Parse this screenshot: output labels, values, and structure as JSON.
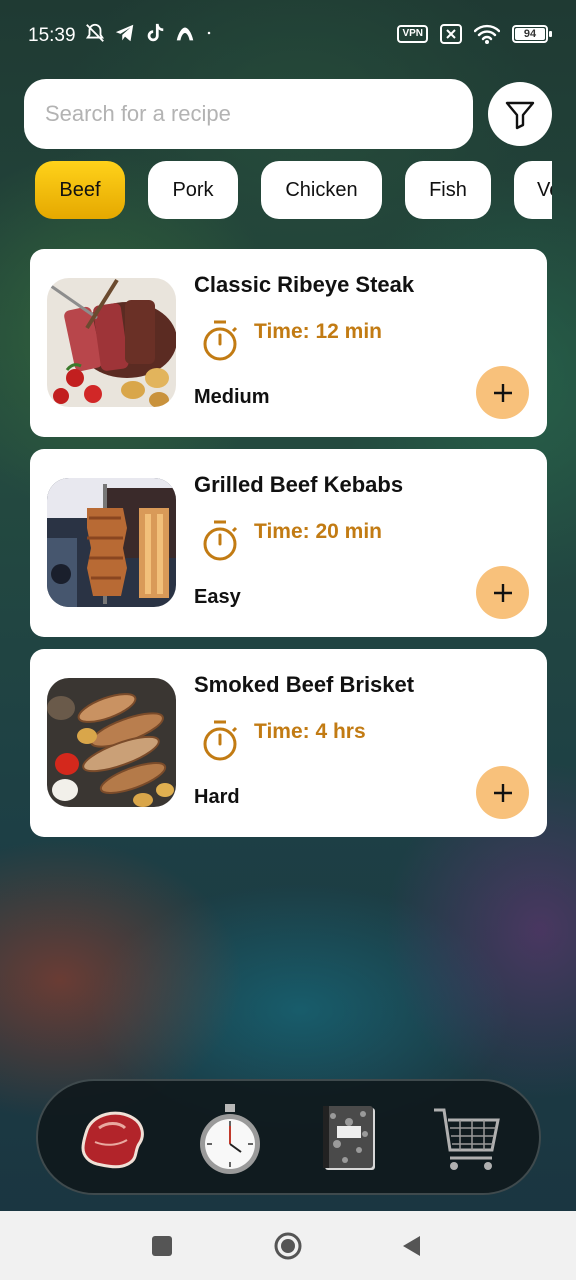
{
  "status_bar": {
    "time": "15:39",
    "vpn": "VPN",
    "battery": "94",
    "icons": [
      "mute-icon",
      "telegram-icon",
      "tiktok-icon",
      "app-icon",
      "wifi-icon",
      "sim-off-icon"
    ]
  },
  "search": {
    "placeholder": "Search for a recipe",
    "value": ""
  },
  "categories": [
    "Beef",
    "Pork",
    "Chicken",
    "Fish",
    "Ve"
  ],
  "active_category": "Beef",
  "recipes": [
    {
      "title": "Classic Ribeye Steak",
      "time": "Time: 12 min",
      "difficulty": "Medium"
    },
    {
      "title": "Grilled Beef Kebabs",
      "time": "Time: 20 min",
      "difficulty": "Easy"
    },
    {
      "title": "Smoked Beef Brisket",
      "time": "Time: 4 hrs",
      "difficulty": "Hard"
    }
  ],
  "bottom_nav": [
    "steak-icon",
    "stopwatch-icon",
    "notebook-icon",
    "shopping-cart-icon"
  ],
  "colors": {
    "accent_chip": "#ffd21a",
    "time_text": "#c27b13",
    "add_button": "#f8c17b",
    "card_bg": "#ffffff"
  }
}
